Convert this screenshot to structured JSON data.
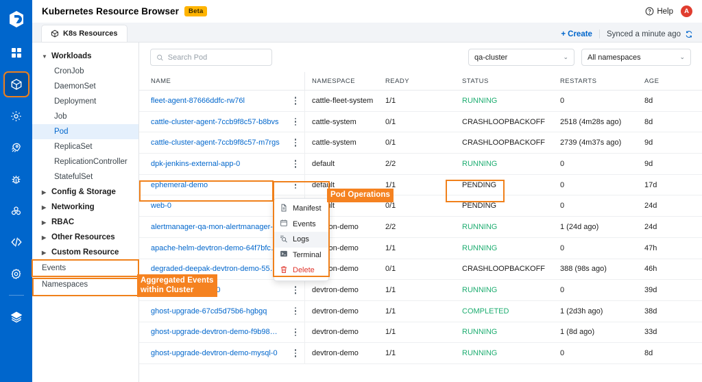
{
  "header": {
    "title": "Kubernetes Resource Browser",
    "badge": "Beta",
    "help_label": "Help",
    "help_icon": "question-circle-icon",
    "avatar_initial": "A",
    "logo_icon": "devtron-logo-icon"
  },
  "rail": {
    "items": [
      {
        "name": "apps-grid-icon",
        "active": false
      },
      {
        "name": "cube-icon",
        "active": true
      },
      {
        "name": "gear-cog-icon",
        "active": false
      },
      {
        "name": "rocket-icon",
        "active": false
      },
      {
        "name": "bug-icon",
        "active": false
      },
      {
        "name": "chart-bubbles-icon",
        "active": false
      },
      {
        "name": "code-brackets-icon",
        "active": false
      },
      {
        "name": "settings-gear-icon",
        "active": false
      },
      {
        "name": "stack-layers-icon",
        "active": false
      }
    ]
  },
  "tabs": [
    {
      "label": "K8s Resources",
      "icon": "cube-icon",
      "active": true
    }
  ],
  "toolbar": {
    "create_label": "Create",
    "create_icon": "plus-icon",
    "sync_label": "Synced a minute ago",
    "sync_icon": "refresh-icon"
  },
  "filters": {
    "search_placeholder": "Search Pod",
    "search_value": "",
    "search_icon": "search-icon",
    "cluster_value": "qa-cluster",
    "namespace_value": "All namespaces"
  },
  "nav": {
    "groups": [
      {
        "label": "Workloads",
        "expanded": true,
        "children": [
          {
            "label": "CronJob",
            "selected": false
          },
          {
            "label": "DaemonSet",
            "selected": false
          },
          {
            "label": "Deployment",
            "selected": false
          },
          {
            "label": "Job",
            "selected": false
          },
          {
            "label": "Pod",
            "selected": true
          },
          {
            "label": "ReplicaSet",
            "selected": false
          },
          {
            "label": "ReplicationController",
            "selected": false
          },
          {
            "label": "StatefulSet",
            "selected": false
          }
        ]
      },
      {
        "label": "Config & Storage",
        "expanded": false,
        "children": []
      },
      {
        "label": "Networking",
        "expanded": false,
        "children": []
      },
      {
        "label": "RBAC",
        "expanded": false,
        "children": []
      },
      {
        "label": "Other Resources",
        "expanded": false,
        "children": []
      },
      {
        "label": "Custom Resource",
        "expanded": false,
        "children": []
      }
    ],
    "leaves": [
      {
        "label": "Events",
        "highlighted": true
      },
      {
        "label": "Namespaces",
        "highlighted": false
      }
    ]
  },
  "table": {
    "columns": [
      "NAME",
      "NAMESPACE",
      "READY",
      "STATUS",
      "RESTARTS",
      "AGE"
    ],
    "rows": [
      {
        "name": "fleet-agent-87666ddfc-rw76l",
        "namespace": "cattle-fleet-system",
        "ready": "1/1",
        "status": "RUNNING",
        "status_color": "green",
        "restarts": "0",
        "age": "8d"
      },
      {
        "name": "cattle-cluster-agent-7ccb9f8c57-b8bvs",
        "namespace": "cattle-system",
        "ready": "0/1",
        "status": "CRASHLOOPBACKOFF",
        "status_color": "dark",
        "restarts": "2518 (4m28s ago)",
        "age": "8d"
      },
      {
        "name": "cattle-cluster-agent-7ccb9f8c57-m7rgs",
        "namespace": "cattle-system",
        "ready": "0/1",
        "status": "CRASHLOOPBACKOFF",
        "status_color": "dark",
        "restarts": "2739 (4m37s ago)",
        "age": "9d"
      },
      {
        "name": "dpk-jenkins-external-app-0",
        "namespace": "default",
        "ready": "2/2",
        "status": "RUNNING",
        "status_color": "green",
        "restarts": "0",
        "age": "9d"
      },
      {
        "name": "ephemeral-demo",
        "namespace": "default",
        "ready": "1/1",
        "status": "PENDING",
        "status_color": "dark",
        "restarts": "0",
        "age": "17d"
      },
      {
        "name": "web-0",
        "namespace": "default",
        "ready": "0/1",
        "status": "PENDING",
        "status_color": "dark",
        "restarts": "0",
        "age": "24d"
      },
      {
        "name": "alertmanager-qa-mon-alertmanager-0",
        "namespace": "devtron-demo",
        "ready": "2/2",
        "status": "RUNNING",
        "status_color": "green",
        "restarts": "1 (24d ago)",
        "age": "24d"
      },
      {
        "name": "apache-helm-devtron-demo-64f7bfccd...",
        "namespace": "devtron-demo",
        "ready": "1/1",
        "status": "RUNNING",
        "status_color": "green",
        "restarts": "0",
        "age": "47h"
      },
      {
        "name": "degraded-deepak-devtron-demo-55cdf...",
        "namespace": "devtron-demo",
        "ready": "0/1",
        "status": "CRASHLOOPBACKOFF",
        "status_color": "dark",
        "restarts": "388 (98s ago)",
        "age": "46h"
      },
      {
        "name": "ghost-mariadb-poc-0",
        "namespace": "devtron-demo",
        "ready": "1/1",
        "status": "RUNNING",
        "status_color": "green",
        "restarts": "0",
        "age": "39d"
      },
      {
        "name": "ghost-upgrade-67cd5d75b6-hgbgq",
        "namespace": "devtron-demo",
        "ready": "1/1",
        "status": "COMPLETED",
        "status_color": "green",
        "restarts": "1 (2d3h ago)",
        "age": "38d"
      },
      {
        "name": "ghost-upgrade-devtron-demo-f9b98b5...",
        "namespace": "devtron-demo",
        "ready": "1/1",
        "status": "RUNNING",
        "status_color": "green",
        "restarts": "1 (8d ago)",
        "age": "33d"
      },
      {
        "name": "ghost-upgrade-devtron-demo-mysql-0",
        "namespace": "devtron-demo",
        "ready": "1/1",
        "status": "RUNNING",
        "status_color": "green",
        "restarts": "0",
        "age": "8d"
      }
    ]
  },
  "context_menu": {
    "items": [
      {
        "label": "Manifest",
        "icon": "document-icon",
        "hovered": false,
        "danger": false
      },
      {
        "label": "Events",
        "icon": "calendar-icon",
        "hovered": false,
        "danger": false
      },
      {
        "label": "Logs",
        "icon": "log-search-icon",
        "hovered": true,
        "danger": false
      },
      {
        "label": "Terminal",
        "icon": "terminal-icon",
        "hovered": false,
        "danger": false
      },
      {
        "label": "Delete",
        "icon": "trash-icon",
        "hovered": false,
        "danger": true
      }
    ]
  },
  "annotations": [
    {
      "text": "Pod Operations",
      "id": "pod-operations"
    },
    {
      "text": "Aggregated Events\nwithin Cluster",
      "id": "aggregated-events"
    }
  ],
  "colors": {
    "brand_blue": "#0066CC",
    "accent_orange": "#F58220",
    "status_green": "#1DAD70",
    "danger_red": "#E0342B",
    "beta_yellow": "#FFB400"
  }
}
